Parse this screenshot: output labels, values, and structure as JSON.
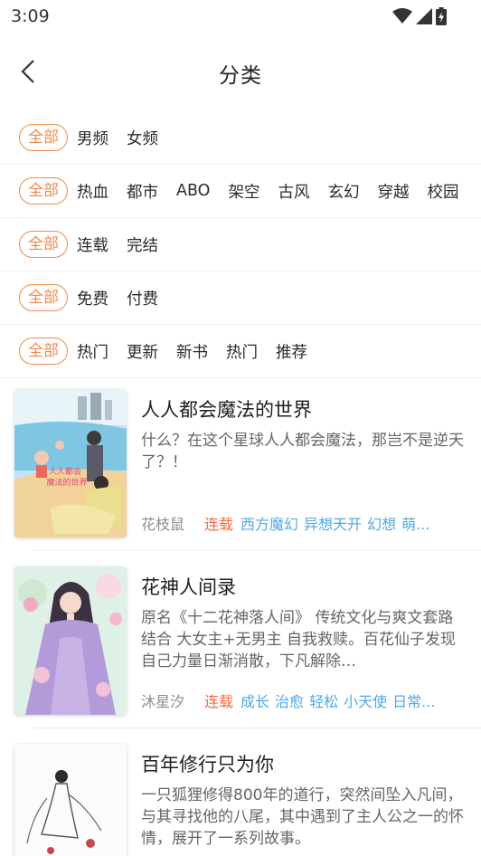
{
  "status_bar": {
    "time": "3:09",
    "icons": [
      "wifi-icon",
      "signal-icon",
      "battery-charging-icon"
    ]
  },
  "header": {
    "title": "分类",
    "back_icon": "chevron-left-icon"
  },
  "filters": [
    {
      "all_label": "全部",
      "options": [
        "男频",
        "女频"
      ]
    },
    {
      "all_label": "全部",
      "options": [
        "热血",
        "都市",
        "ABO",
        "架空",
        "古风",
        "玄幻",
        "穿越",
        "校园"
      ]
    },
    {
      "all_label": "全部",
      "options": [
        "连载",
        "完结"
      ]
    },
    {
      "all_label": "全部",
      "options": [
        "免费",
        "付费"
      ]
    },
    {
      "all_label": "全部",
      "options": [
        "热门",
        "更新",
        "新书",
        "热门",
        "推荐"
      ]
    }
  ],
  "books": [
    {
      "title": "人人都会魔法的世界",
      "description": "什么？在这个星球人人都会魔法，那岂不是逆天了？！",
      "author": "花枝鼠",
      "status": "连载",
      "tags": [
        "西方魔幻",
        "异想天开",
        "幻想",
        "萌..."
      ]
    },
    {
      "title": "花神人间录",
      "description": "原名《十二花神落人间》 传统文化与爽文套路结合 大女主+无男主 自我救赎。百花仙子发现自己力量日渐消散，下凡解除…",
      "author": "沐星汐",
      "status": "连载",
      "tags": [
        "成长",
        "治愈",
        "轻松",
        "小天使",
        "日常..."
      ]
    },
    {
      "title": "百年修行只为你",
      "description": "一只狐狸修得800年的道行，突然间坠入凡间，与其寻找他的八尾，其中遇到了主人公之一的怀情，展开了一系列故事。",
      "author": "",
      "status": "",
      "tags": []
    }
  ],
  "colors": {
    "accent": "#f2894e",
    "status_tag": "#f26d3d",
    "genre_tag": "#4fa9e6",
    "divider": "#eeeeee"
  }
}
